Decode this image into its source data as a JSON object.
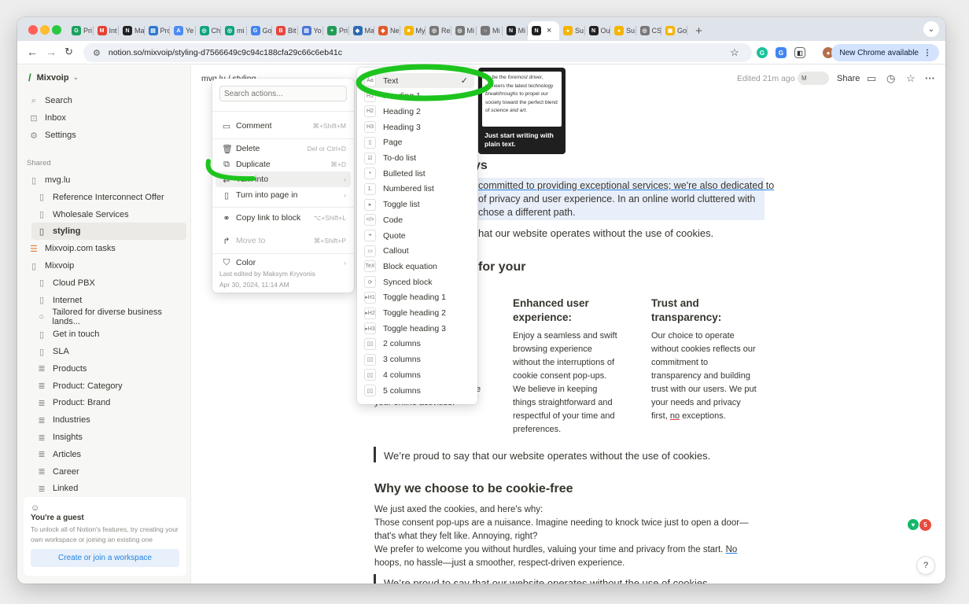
{
  "browser": {
    "tabs": [
      {
        "label": "Pri",
        "color": "#1aa260",
        "glyph": "G"
      },
      {
        "label": "Int",
        "color": "#e44134",
        "glyph": "M"
      },
      {
        "label": "Ma",
        "color": "#222222",
        "glyph": "N"
      },
      {
        "label": "Pro",
        "color": "#2e77d0",
        "glyph": "▤"
      },
      {
        "label": "Ye",
        "color": "#4c8bf5",
        "glyph": "A"
      },
      {
        "label": "Ch",
        "color": "#10a37f",
        "glyph": "◎"
      },
      {
        "label": "mi",
        "color": "#10a37f",
        "glyph": "◎"
      },
      {
        "label": "Go",
        "color": "#4285f4",
        "glyph": "G"
      },
      {
        "label": "Bit",
        "color": "#e8453c",
        "glyph": "B"
      },
      {
        "label": "Yo",
        "color": "#4a76d4",
        "glyph": "▤"
      },
      {
        "label": "Pri",
        "color": "#1f9d55",
        "glyph": "+"
      },
      {
        "label": "Ma",
        "color": "#2b6cb0",
        "glyph": "◆"
      },
      {
        "label": "Ne",
        "color": "#e2592a",
        "glyph": "◆"
      },
      {
        "label": "My",
        "color": "#f4b400",
        "glyph": "■"
      },
      {
        "label": "Re",
        "color": "#777777",
        "glyph": "◎"
      },
      {
        "label": "Mi",
        "color": "#777777",
        "glyph": "◎"
      },
      {
        "label": "Mi",
        "color": "#777777",
        "glyph": "○"
      },
      {
        "label": "Mi",
        "color": "#222222",
        "glyph": "N"
      },
      {
        "label": "",
        "color": "#222222",
        "glyph": "N",
        "active": true
      },
      {
        "label": "Su",
        "color": "#f5b400",
        "glyph": "●"
      },
      {
        "label": "Ou",
        "color": "#222222",
        "glyph": "N"
      },
      {
        "label": "Su",
        "color": "#f5b400",
        "glyph": "●"
      },
      {
        "label": "CS",
        "color": "#777777",
        "glyph": "◎"
      },
      {
        "label": "Go",
        "color": "#f5b400",
        "glyph": "▣"
      }
    ],
    "url": "notion.so/mixvoip/styling-d7566649c9c94c188cfa29c66c6eb41c",
    "update_label": "New Chrome available"
  },
  "sidebar": {
    "workspace": "Mixvoip",
    "items": [
      {
        "label": "Search",
        "icon": "search-icon",
        "glyph": "⌕"
      },
      {
        "label": "Inbox",
        "icon": "inbox-icon",
        "glyph": "⊡"
      },
      {
        "label": "Settings",
        "icon": "gear-icon",
        "glyph": "⚙"
      }
    ],
    "shared_header": "Shared",
    "pages": [
      {
        "label": "mvg.lu",
        "glyph": "▯",
        "child": false
      },
      {
        "label": "Reference Interconnect Offer",
        "glyph": "▯",
        "child": true
      },
      {
        "label": "Wholesale Services",
        "glyph": "▯",
        "child": true
      },
      {
        "label": "styling",
        "glyph": "▯",
        "child": true,
        "selected": true
      },
      {
        "label": "Mixvoip.com tasks",
        "glyph": "☰",
        "child": false,
        "accent": "#e07b39"
      },
      {
        "label": "Mixvoip",
        "glyph": "▯",
        "child": false
      },
      {
        "label": "Cloud PBX",
        "glyph": "▯",
        "child": true
      },
      {
        "label": "Internet",
        "glyph": "▯",
        "child": true
      },
      {
        "label": "Tailored for diverse business lands...",
        "glyph": "○",
        "child": true
      },
      {
        "label": "Get in touch",
        "glyph": "▯",
        "child": true
      },
      {
        "label": "SLA",
        "glyph": "▯",
        "child": true
      },
      {
        "label": "Products",
        "glyph": "≣",
        "child": true
      },
      {
        "label": "Product: Category",
        "glyph": "≣",
        "child": true
      },
      {
        "label": "Product: Brand",
        "glyph": "≣",
        "child": true
      },
      {
        "label": "Industries",
        "glyph": "≣",
        "child": true
      },
      {
        "label": "Insights",
        "glyph": "≣",
        "child": true
      },
      {
        "label": "Articles",
        "glyph": "≣",
        "child": true
      },
      {
        "label": "Career",
        "glyph": "≣",
        "child": true
      },
      {
        "label": "Linked",
        "glyph": "≣",
        "child": true
      }
    ],
    "guest": {
      "title": "You're a guest",
      "desc": "To unlock all of Notion's features, try creating your own workspace or joining an existing one",
      "button": "Create or join a workspace"
    }
  },
  "topbar": {
    "crumb": "mvg.lu / styling",
    "edited": "Edited 21m ago",
    "avatar_initial": "M",
    "share": "Share"
  },
  "context_menu": {
    "search_placeholder": "Search actions...",
    "items": [
      {
        "label": "Comment",
        "icon": "comment-icon",
        "glyph": "▭",
        "kbd": "⌘+Shift+M"
      },
      {
        "label": "Delete",
        "icon": "trash-icon",
        "glyph": "🗑",
        "kbd": "Del or Ctrl+D"
      },
      {
        "label": "Duplicate",
        "icon": "duplicate-icon",
        "glyph": "⧉",
        "kbd": "⌘+D"
      },
      {
        "label": "Turn into",
        "icon": "turn-into-icon",
        "glyph": "⇄",
        "kbd": "›",
        "hover": true
      },
      {
        "label": "Turn into page in",
        "icon": "page-icon",
        "glyph": "▯",
        "kbd": "›"
      },
      {
        "label": "Copy link to block",
        "icon": "link-icon",
        "glyph": "⚭",
        "kbd": "⌥+Shift+L"
      },
      {
        "label": "Move to",
        "icon": "move-icon",
        "glyph": "↱",
        "kbd": "⌘+Shift+P",
        "dim": true
      },
      {
        "label": "Color",
        "icon": "paint-icon",
        "glyph": "⛉",
        "kbd": "›"
      }
    ],
    "footer_line1": "Last edited by Maksym Kryvonis",
    "footer_line2": "Apr 30, 2024, 11:14 AM"
  },
  "turn_into_menu": {
    "items": [
      {
        "label": "Text",
        "glyph": "Aa",
        "selected": true
      },
      {
        "label": "Heading 1",
        "glyph": "H1"
      },
      {
        "label": "Heading 2",
        "glyph": "H2"
      },
      {
        "label": "Heading 3",
        "glyph": "H3"
      },
      {
        "label": "Page",
        "glyph": "▯"
      },
      {
        "label": "To-do list",
        "glyph": "☑"
      },
      {
        "label": "Bulleted list",
        "glyph": "•"
      },
      {
        "label": "Numbered list",
        "glyph": "1."
      },
      {
        "label": "Toggle list",
        "glyph": "▸"
      },
      {
        "label": "Code",
        "glyph": "</>"
      },
      {
        "label": "Quote",
        "glyph": "❝"
      },
      {
        "label": "Callout",
        "glyph": "▭"
      },
      {
        "label": "Block equation",
        "glyph": "TeX"
      },
      {
        "label": "Synced block",
        "glyph": "⟳"
      },
      {
        "label": "Toggle heading 1",
        "glyph": "▸H1"
      },
      {
        "label": "Toggle heading 2",
        "glyph": "▸H2"
      },
      {
        "label": "Toggle heading 3",
        "glyph": "▸H3"
      },
      {
        "label": "2 columns",
        "glyph": "▯▯"
      },
      {
        "label": "3 columns",
        "glyph": "▯▯"
      },
      {
        "label": "4 columns",
        "glyph": "▯▯"
      },
      {
        "label": "5 columns",
        "glyph": "▯▯"
      }
    ],
    "check": "✓"
  },
  "preview": {
    "sample_a": "To be the ",
    "sample_b": "foremost",
    "sample_c": " driver, pioneers the latest technology ",
    "sample_d": "breakthroughs",
    "sample_e": " to propel our society toward the perfect blend of ",
    "sample_f": "science and art.",
    "caption": "Just start writing with plain text."
  },
  "content": {
    "heading_partial": "ys",
    "para1_l1": "committed to providing exceptional services; we're also dedicated to",
    "para1_l2": "of privacy and user experience. In an online world cluttered with",
    "para1_l3": "chose a different path.",
    "quote_partial": "hat our website operates without the use of cookies.",
    "heading2_partial": "for your",
    "col_mid_title_1": "Enhanced user",
    "col_mid_title_2": "experience:",
    "col_mid_body": [
      "Enjoy a seamless and swift",
      "browsing experience",
      "without the interruptions of",
      "cookie consent pop-ups.",
      "We believe in keeping",
      "things straightforward and",
      "respectful of your time and",
      "preferences."
    ],
    "col_right_title_1": "Trust and",
    "col_right_title_2": "transparency:",
    "col_right_body": [
      "Our choice to operate",
      "without cookies reflects our",
      "commitment to",
      "transparency and building",
      "trust with our users. We put",
      "your needs and privacy",
      "first, "
    ],
    "col_right_no": "no",
    "col_right_end": " exceptions.",
    "col_left_frag1": "e",
    "col_left_frag2": "your online activities.",
    "quote2": "We’re proud to say that our website operates without the use of cookies.",
    "heading3": "Why we choose to be cookie-free",
    "p2_l1": "We just axed the cookies, and here's why:",
    "p2_l2": "Those consent pop-ups are a nuisance. Imagine needing to knock twice just to open a door—",
    "p2_l3": "that's what they felt like. Annoying, right?",
    "p2_l4": "We prefer to welcome you without hurdles, valuing your time and privacy from the start. ",
    "p2_l4_no": "No",
    "p2_l5": "hoops, no hassle—just a smoother, respect-driven experience.",
    "quote3": "We’re proud to say that our website operates without the use of cookies."
  },
  "misc": {
    "help": "?",
    "grammarly_count": "5"
  },
  "colors": {
    "annotation": "#1ec41e",
    "accent": "#2383e2",
    "highlight": "#e8effa"
  }
}
